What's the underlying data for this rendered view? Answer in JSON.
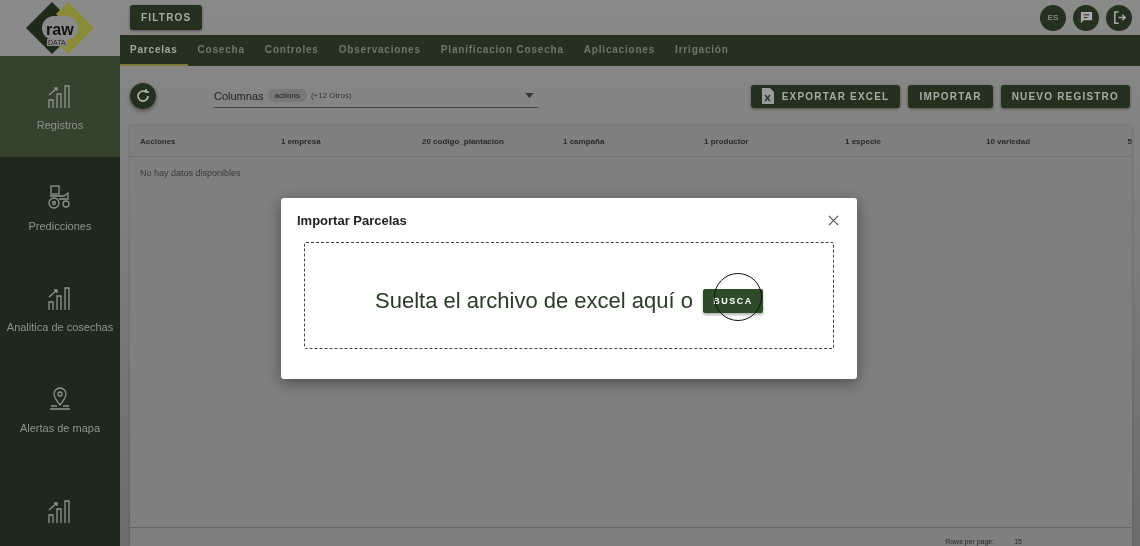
{
  "logo": {
    "word": "raw",
    "subword": "DATA"
  },
  "sidebar": {
    "items": [
      {
        "label": "Registros",
        "selected": true
      },
      {
        "label": "Predicciones",
        "selected": false
      },
      {
        "label": "Analitica de cosechas",
        "selected": false
      },
      {
        "label": "Alertas de mapa",
        "selected": false
      },
      {
        "selected": false
      }
    ]
  },
  "topbar": {
    "filter_button": "FILTROS",
    "language": "ES"
  },
  "tabs": [
    {
      "label": "Parcelas",
      "selected": true
    },
    {
      "label": "Cosecha",
      "selected": false
    },
    {
      "label": "Controles",
      "selected": false
    },
    {
      "label": "Observaciones",
      "selected": false
    },
    {
      "label": "Planificacion Cosecha",
      "selected": false
    },
    {
      "label": "Aplicaciones",
      "selected": false
    },
    {
      "label": "Irrigación",
      "selected": false
    }
  ],
  "toolbar": {
    "columns_label": "Columnas",
    "chip": "actions",
    "more": "(+12 Otros)",
    "buttons": [
      {
        "label": "EXPORTAR EXCEL",
        "kind": "excel"
      },
      {
        "label": "IMPORTAR",
        "kind": "plain"
      },
      {
        "label": "NUEVO REGISTRO",
        "kind": "plain"
      }
    ]
  },
  "table": {
    "columns": [
      "Acciones",
      "1 empresa",
      "20 codigo_plantacion",
      "1 campaña",
      "1 productor",
      "1 especie",
      "10 variedad",
      "5"
    ],
    "empty": "No hay datos disponibles"
  },
  "pagination": {
    "rows_per_page": "Rows per page:",
    "value": "15"
  },
  "dialog": {
    "title": "Importar Parcelas",
    "drop_text": "Suelta el archivo de excel aquí o",
    "button": "BUSCA"
  }
}
